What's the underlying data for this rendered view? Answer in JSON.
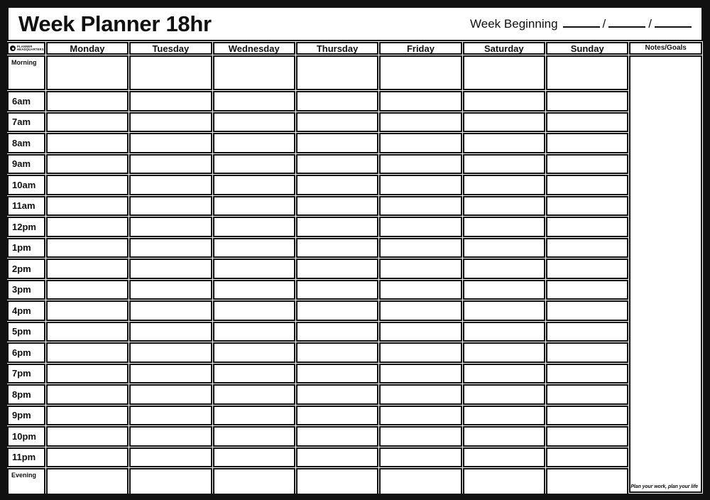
{
  "title": "Week Planner 18hr",
  "week_beginning": {
    "label": "Week Beginning",
    "slash": "/",
    "blank": ""
  },
  "logo": {
    "mark": "circle-target-icon",
    "line1": "PLANNER",
    "line2": "HEADQUARTERS"
  },
  "columns": {
    "time_header": "",
    "days": [
      "Monday",
      "Tuesday",
      "Wednesday",
      "Thursday",
      "Friday",
      "Saturday",
      "Sunday"
    ],
    "notes_header": "Notes/Goals"
  },
  "rows": {
    "morning_label": "Morning",
    "evening_label": "Evening",
    "hours": [
      "6am",
      "7am",
      "8am",
      "9am",
      "10am",
      "11am",
      "12pm",
      "1pm",
      "2pm",
      "3pm",
      "4pm",
      "5pm",
      "6pm",
      "7pm",
      "8pm",
      "9pm",
      "10pm",
      "11pm"
    ]
  },
  "tagline": "Plan your work, plan your life",
  "colors": {
    "frame": "#111111",
    "line": "#111111",
    "paper": "#ffffff"
  }
}
